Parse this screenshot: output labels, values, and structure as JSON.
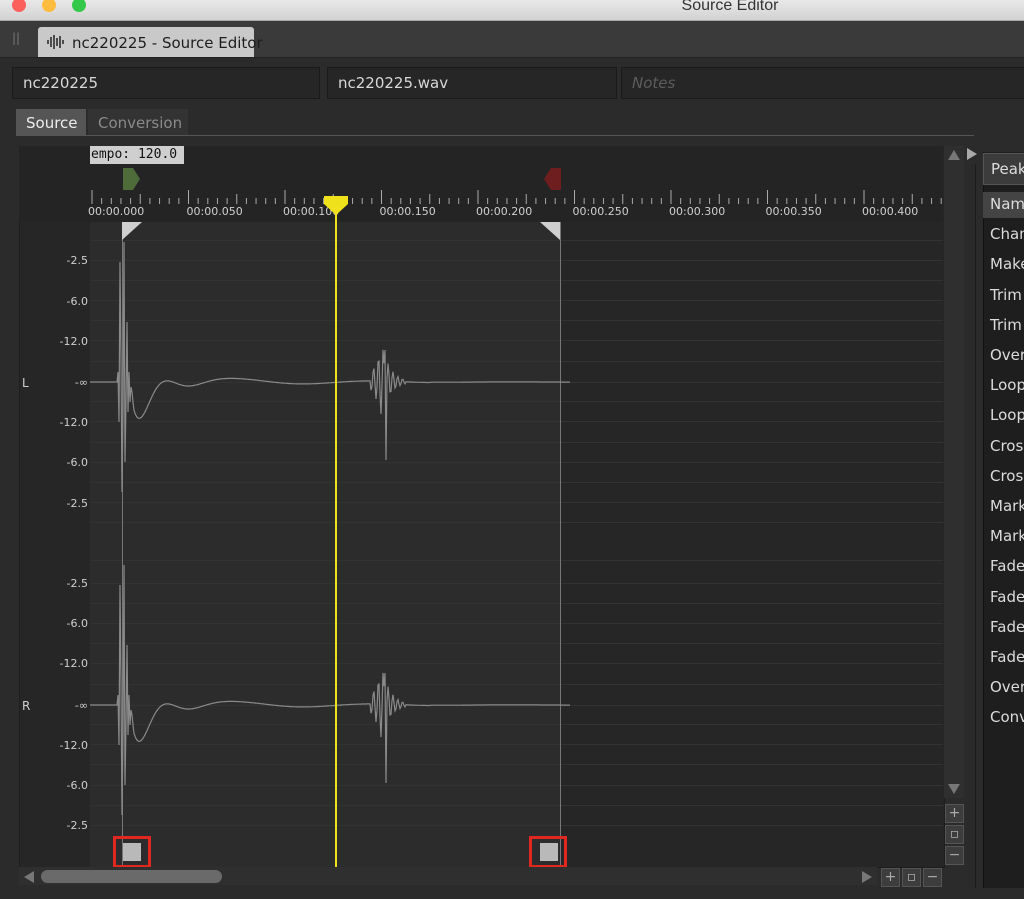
{
  "window": {
    "title": "Source Editor"
  },
  "colors": {
    "accent_yellow": "#f0e21a",
    "highlight_red": "#e0281e",
    "start_marker": "#4e6b3a",
    "end_marker": "#6e1e1e"
  },
  "tab": {
    "label": "nc220225 - Source Editor",
    "icon": "waveform-icon"
  },
  "fields": {
    "name": "nc220225",
    "file": "nc220225.wav",
    "notes_placeholder": "Notes"
  },
  "subtabs": [
    "Source",
    "Conversion"
  ],
  "tempo": "empo: 120.0",
  "timeline": {
    "labels": [
      "00:00.000",
      "00:00.050",
      "00:00.100",
      "00:00.150",
      "00:00.200",
      "00:00.250",
      "00:00.300",
      "00:00.350",
      "00:00.400"
    ]
  },
  "channels": {
    "left": {
      "label": "L",
      "db": [
        "-2.5",
        "-6.0",
        "-12.0",
        "-∞",
        "-12.0",
        "-6.0",
        "-2.5"
      ]
    },
    "right": {
      "label": "R",
      "db": [
        "-2.5",
        "-6.0",
        "-12.0",
        "-∞",
        "-12.0",
        "-6.0",
        "-2.5"
      ]
    }
  },
  "panel": {
    "dropdown": "Peak",
    "items": [
      "Name",
      "Chan",
      "Make",
      "Trim",
      "Trim",
      "Over",
      "Loop",
      "Loop",
      "Cross",
      "Cross",
      "Mark",
      "Mark",
      "Fade",
      "Fade",
      "Fade",
      "Fade",
      "Over",
      "Conv"
    ]
  }
}
